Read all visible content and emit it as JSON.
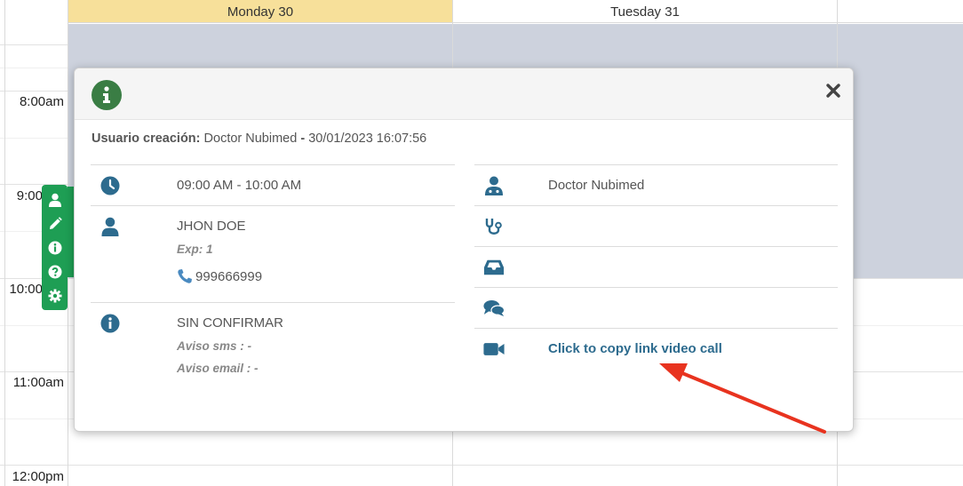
{
  "calendar": {
    "days": [
      {
        "label": "Monday 30",
        "today": true
      },
      {
        "label": "Tuesday 31",
        "today": false
      }
    ],
    "times": [
      "8:00am",
      "9:00",
      "10:00",
      "11:00am",
      "12:00pm"
    ]
  },
  "toolbar": {
    "icons": [
      "user-icon",
      "pencil-icon",
      "info-icon",
      "question-icon",
      "gear-icon"
    ]
  },
  "modal": {
    "creator_label": "Usuario creación:",
    "creator_name": "Doctor Nubimed",
    "creator_sep": "-",
    "creator_date": "30/01/2023 16:07:56",
    "left": {
      "time": "09:00 AM - 10:00 AM",
      "patient_name": "JHON DOE",
      "exp": "Exp: 1",
      "phone": "999666999",
      "status": "SIN CONFIRMAR",
      "sms": "Aviso sms : -",
      "email": "Aviso email : -"
    },
    "right": {
      "doctor": "Doctor Nubimed",
      "video_link": "Click to copy link video call"
    }
  },
  "colors": {
    "accent_green": "#1e9e54",
    "icon_blue": "#2d6b8e",
    "today_header": "#f7e09a",
    "arrow_red": "#e8331f"
  }
}
